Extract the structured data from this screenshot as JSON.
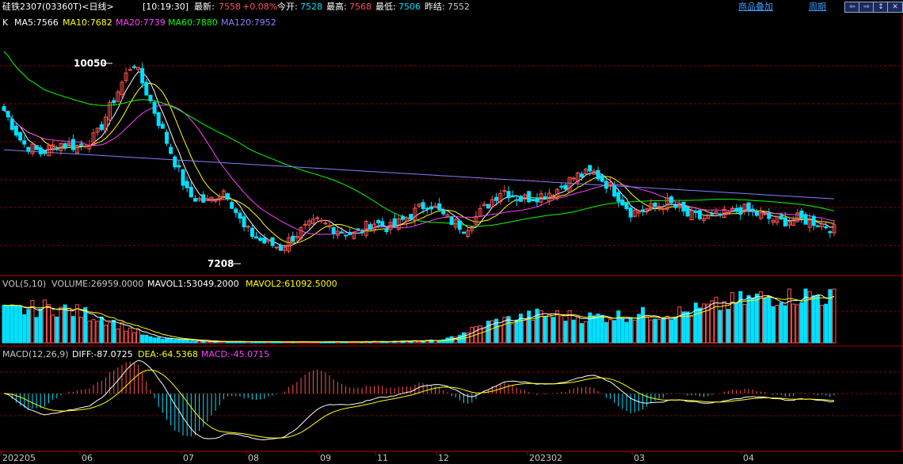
{
  "header": {
    "title": "硅铁2307(03360T)<日线>",
    "time": "[10:19:30]",
    "latest_label": "最新:",
    "latest_value": "7558",
    "latest_change": "+0.08%",
    "open_label": "今开:",
    "open_value": "7528",
    "high_label": "最高:",
    "high_value": "7568",
    "low_label": "最低:",
    "low_value": "7506",
    "prev_close_label": "昨结:",
    "prev_close_value": "7552",
    "overlay_link": "商品叠加",
    "period_link": "周期",
    "nav_buttons": [
      "⇦",
      "⇨",
      "↕",
      "✕"
    ]
  },
  "price_panel": {
    "prefix": "K",
    "ma5": "MA5:7566",
    "ma10": "MA10:7682",
    "ma20": "MA20:7739",
    "ma60": "MA60:7880",
    "ma120": "MA120:7952",
    "high_marker": "10050",
    "low_marker": "7208"
  },
  "volume_panel": {
    "label": "VOL(5,10)",
    "volume": "VOLUME:26959.0000",
    "mavol1": "MAVOL1:53049.2000",
    "mavol2": "MAVOL2:61092.5000"
  },
  "macd_panel": {
    "label": "MACD(12,26,9)",
    "diff": "DIFF:-87.0725",
    "dea": "DEA:-64.5368",
    "macd": "MACD:-45.0715"
  },
  "colors": {
    "up": "#ff5050",
    "down": "#00e0ff",
    "ma5": "#ffffff",
    "ma10": "#ffff00",
    "ma20": "#ff40ff",
    "ma60": "#00ff00",
    "ma120": "#8080ff",
    "grid": "#8b0000"
  },
  "x_axis_labels": [
    "202205",
    "06",
    "07",
    "08",
    "09",
    "11",
    "12",
    "202302",
    "03",
    "04"
  ],
  "chart_data": {
    "type": "candlestick",
    "price_range": [
      7000,
      10500
    ],
    "highest": 10050,
    "lowest": 7208,
    "ma_last": {
      "MA5": 7566,
      "MA10": 7682,
      "MA20": 7739,
      "MA60": 7880,
      "MA120": 7952
    },
    "close_path": [
      9300,
      8800,
      8650,
      8800,
      8750,
      8900,
      9500,
      10050,
      9400,
      8700,
      8000,
      7900,
      8100,
      7500,
      7300,
      7208,
      7450,
      7600,
      7500,
      7400,
      7600,
      7500,
      7700,
      7900,
      7650,
      7500,
      7800,
      8100,
      7950,
      8000,
      8100,
      8300,
      8350,
      8100,
      7750,
      7800,
      7900,
      7700,
      7650,
      7700,
      7800,
      7700,
      7600,
      7650,
      7600,
      7500
    ],
    "volume_profile": [
      0.6,
      0.7,
      0.5,
      0.1,
      0.03,
      0.02,
      0.02,
      0.02,
      0.03,
      0.05,
      0.4,
      0.55,
      0.5,
      0.55,
      0.6,
      0.8,
      0.95,
      0.9
    ],
    "macd_last": {
      "DIFF": -87.0725,
      "DEA": -64.5368,
      "MACD": -45.0715
    }
  }
}
